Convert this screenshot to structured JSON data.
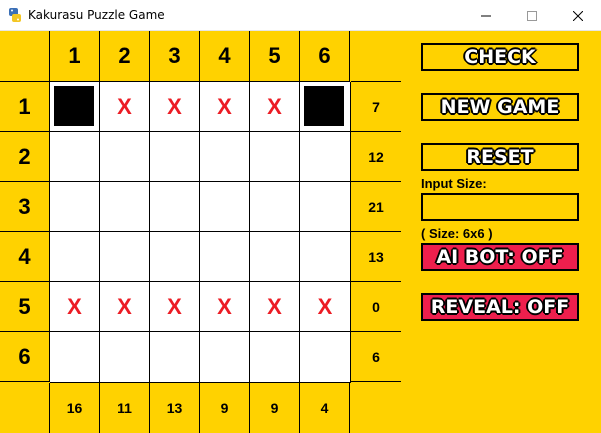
{
  "window": {
    "title": "Kakurasu Puzzle Game",
    "minimize_glyph": "—",
    "maximize_glyph": "☐",
    "close_glyph": "✕"
  },
  "colors": {
    "background": "#ffd200",
    "accent_red": "#ee1f4d",
    "mark_red": "#ec1c24"
  },
  "puzzle": {
    "size": 6,
    "column_headers": [
      "1",
      "2",
      "3",
      "4",
      "5",
      "6"
    ],
    "row_headers": [
      "1",
      "2",
      "3",
      "4",
      "5",
      "6"
    ],
    "row_targets": [
      "7",
      "12",
      "21",
      "13",
      "0",
      "6"
    ],
    "column_targets": [
      "16",
      "11",
      "13",
      "9",
      "9",
      "4"
    ],
    "cells": [
      [
        "filled",
        "x",
        "x",
        "x",
        "x",
        "filled"
      ],
      [
        "",
        "",
        "",
        "",
        "",
        ""
      ],
      [
        "",
        "",
        "",
        "",
        "",
        ""
      ],
      [
        "",
        "",
        "",
        "",
        "",
        ""
      ],
      [
        "x",
        "x",
        "x",
        "x",
        "x",
        "x"
      ],
      [
        "",
        "",
        "",
        "",
        "",
        ""
      ]
    ],
    "x_glyph": "X"
  },
  "controls": {
    "check_label": "CHECK",
    "new_game_label": "NEW GAME",
    "reset_label": "RESET",
    "input_size_label": "Input Size:",
    "input_size_value": "",
    "size_label": "( Size: 6x6 )",
    "ai_bot_label": "AI BOT: OFF",
    "reveal_label": "REVEAL: OFF"
  }
}
